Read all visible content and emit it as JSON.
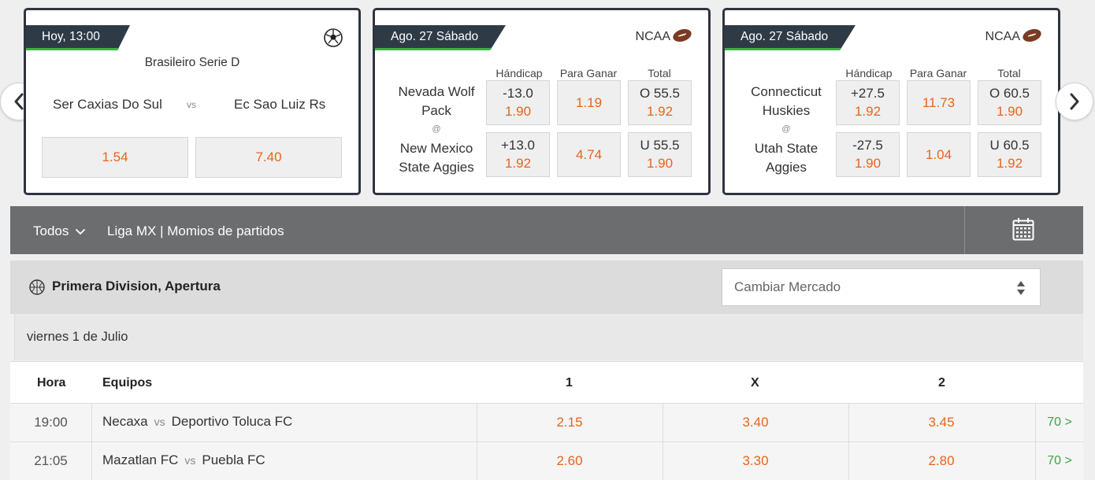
{
  "carousel": {
    "card1": {
      "date": "Hoy, 13:00",
      "sport_icon": "soccer-ball-icon",
      "league": "Brasileiro Serie D",
      "home": "Ser Caxias Do Sul",
      "vs": "vs",
      "away": "Ec Sao Luiz Rs",
      "odd_home": "1.54",
      "odd_away": "7.40"
    },
    "card2": {
      "date": "Ago. 27 Sábado",
      "league": "NCAA",
      "sport_icon": "american-football-icon",
      "headers": [
        "Hándicap",
        "Para Ganar",
        "Total"
      ],
      "team1": "Nevada Wolf Pack",
      "at": "@",
      "team2": "New Mexico State Aggies",
      "row1": {
        "handicap": "-13.0",
        "handicap_odd": "1.90",
        "win": "1.19",
        "total": "O 55.5",
        "total_odd": "1.92"
      },
      "row2": {
        "handicap": "+13.0",
        "handicap_odd": "1.92",
        "win": "4.74",
        "total": "U 55.5",
        "total_odd": "1.90"
      }
    },
    "card3": {
      "date": "Ago. 27 Sábado",
      "league": "NCAA",
      "sport_icon": "american-football-icon",
      "headers": [
        "Hándicap",
        "Para Ganar",
        "Total"
      ],
      "team1": "Connecticut Huskies",
      "at": "@",
      "team2": "Utah State Aggies",
      "row1": {
        "handicap": "+27.5",
        "handicap_odd": "1.92",
        "win": "11.73",
        "total": "O 60.5",
        "total_odd": "1.90"
      },
      "row2": {
        "handicap": "-27.5",
        "handicap_odd": "1.90",
        "win": "1.04",
        "total": "U 60.5",
        "total_odd": "1.92"
      }
    }
  },
  "filter": {
    "todos": "Todos",
    "title": "Liga MX | Momios de partidos"
  },
  "section": {
    "title": "Primera Division, Apertura",
    "market_placeholder": "Cambiar Mercado",
    "date": "viernes 1 de Julio"
  },
  "table": {
    "headers": {
      "hora": "Hora",
      "equipos": "Equipos",
      "c1": "1",
      "cx": "X",
      "c2": "2"
    },
    "rows": [
      {
        "time": "19:00",
        "home": "Necaxa",
        "vs": "vs",
        "away": "Deportivo Toluca FC",
        "o1": "2.15",
        "ox": "3.40",
        "o2": "3.45",
        "more": "70 >"
      },
      {
        "time": "21:05",
        "home": "Mazatlan FC",
        "vs": "vs",
        "away": "Puebla FC",
        "o1": "2.60",
        "ox": "3.30",
        "o2": "2.80",
        "more": "70 >"
      }
    ]
  },
  "colors": {
    "odds": "#e8641b",
    "accent_green": "#3cb043",
    "card_border": "#2e3440",
    "filterbar": "#6b6d6f"
  }
}
